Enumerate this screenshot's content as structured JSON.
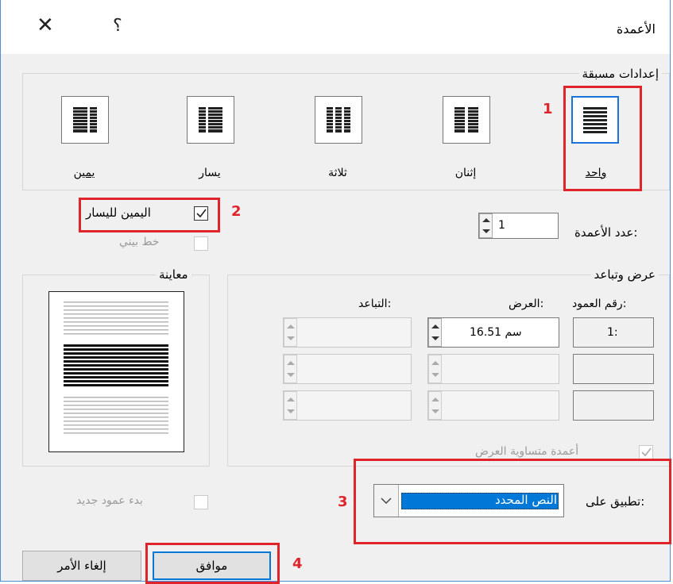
{
  "dialog": {
    "title": "الأعمدة",
    "close_icon": "close-icon",
    "help_label": "؟"
  },
  "presets": {
    "group_label": "إعدادات مسبقة",
    "items": [
      {
        "label": "واحد",
        "selected": true
      },
      {
        "label": "إثنان",
        "selected": false
      },
      {
        "label": "ثلاثة",
        "selected": false
      },
      {
        "label": "يسار",
        "selected": false
      },
      {
        "label": "يمين",
        "selected": false
      }
    ]
  },
  "columns_count": {
    "label": "عدد الأعمدة:",
    "value": "1"
  },
  "right_to_left": {
    "label": "اليمين لليسار",
    "checked": true
  },
  "line_between": {
    "label": "خط بيني",
    "checked": false,
    "enabled": false
  },
  "width_spacing": {
    "group_label": "عرض وتباعد",
    "col_header": "رقم العمود:",
    "width_header": "العرض:",
    "spacing_header": "التباعد:",
    "rows": [
      {
        "col": "1:",
        "width": "16.51 سم",
        "spacing": ""
      },
      {
        "col": "",
        "width": "",
        "spacing": ""
      },
      {
        "col": "",
        "width": "",
        "spacing": ""
      }
    ],
    "equal_width": {
      "label": "أعمدة متساوية العرض",
      "checked": true,
      "enabled": false
    }
  },
  "preview": {
    "label": "معاينة"
  },
  "apply_to": {
    "label": "تطبيق على:",
    "value": "النص المحدد"
  },
  "new_column": {
    "label": "بدء عمود جديد",
    "checked": false,
    "enabled": false
  },
  "buttons": {
    "ok": "موافق",
    "cancel": "إلغاء الأمر"
  },
  "annotations": {
    "n1": "1",
    "n2": "2",
    "n3": "3",
    "n4": "4",
    "color": "#e0242c"
  },
  "colors": {
    "accent": "#0078d7",
    "selection": "#0078d7"
  }
}
